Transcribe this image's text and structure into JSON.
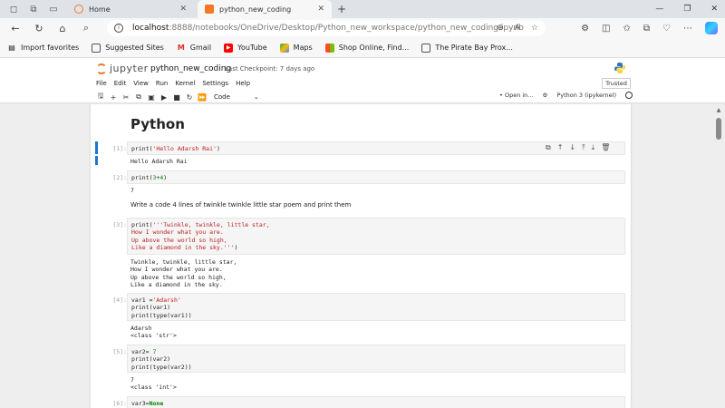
{
  "browser": {
    "tabs": [
      {
        "label": "Home",
        "active": false
      },
      {
        "label": "python_new_coding",
        "active": true
      }
    ],
    "url_host": "localhost",
    "url_path": ":8888/notebooks/OneDrive/Desktop/Python_new_workspace/python_new_coding.ipynb",
    "bookmarks": [
      "Import favorites",
      "Suggested Sites",
      "Gmail",
      "YouTube",
      "Maps",
      "Shop Online, Find...",
      "The Pirate Bay Prox..."
    ]
  },
  "jupyter": {
    "logo_text": "jupyter",
    "notebook_name": "python_new_coding",
    "checkpoint": "Last Checkpoint: 7 days ago",
    "menu": [
      "File",
      "Edit",
      "View",
      "Run",
      "Kernel",
      "Settings",
      "Help"
    ],
    "trusted": "Trusted",
    "cell_type": "Code",
    "open_in": "• Open in...",
    "kernel": "Python 3 (ipykernel)"
  },
  "notebook": {
    "heading": "Python",
    "cells": [
      {
        "prompt": "[1]:",
        "code": "print('Hello Adarsh Rai')",
        "output": "Hello Adarsh Rai"
      },
      {
        "prompt": "[2]:",
        "code": "print(3+4)",
        "output": "7"
      },
      {
        "markdown": "Write a code 4 lines of twinkle twinkle little star poem and print them"
      },
      {
        "prompt": "[3]:",
        "code": "print('''Twinkle, twinkle, little star,\nHow I wonder what you are.\nUp above the world so high,\nLike a diamond in the sky.''')",
        "output": "Twinkle, twinkle, little star,\nHow I wonder what you are.\nUp above the world so high,\nLike a diamond in the sky."
      },
      {
        "prompt": "[4]:",
        "code": "var1 ='Adarsh'\nprint(var1)\nprint(type(var1))",
        "output": "Adarsh\n<class 'str'>"
      },
      {
        "prompt": "[5]:",
        "code": "var2= 7\nprint(var2)\nprint(type(var2))",
        "output": "7\n<class 'int'>"
      },
      {
        "prompt": "[6]:",
        "code": "var3=None"
      }
    ]
  },
  "colors": {
    "accent": "#1976d2",
    "jupyter_orange": "#f37726",
    "string": "#ba2121"
  }
}
